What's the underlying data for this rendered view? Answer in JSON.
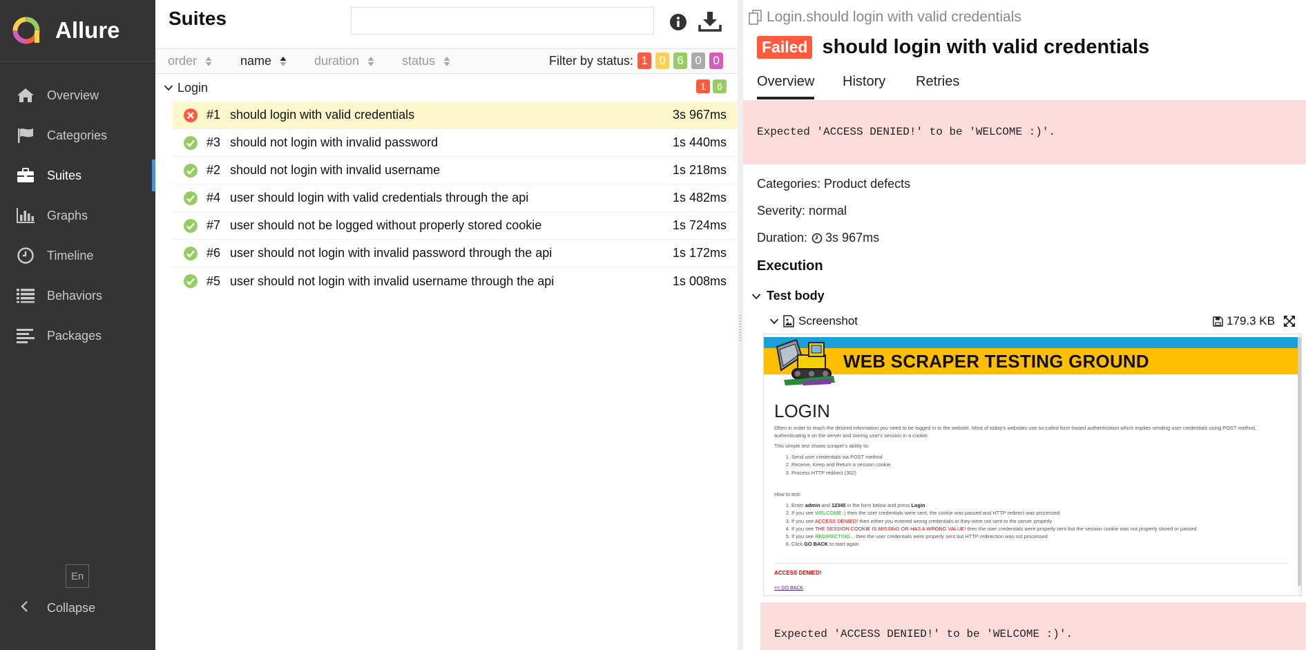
{
  "app": {
    "name": "Allure"
  },
  "sidebar": {
    "items": [
      {
        "label": "Overview",
        "icon": "home-icon"
      },
      {
        "label": "Categories",
        "icon": "flag-icon"
      },
      {
        "label": "Suites",
        "icon": "briefcase-icon",
        "active": true
      },
      {
        "label": "Graphs",
        "icon": "bar-chart-icon"
      },
      {
        "label": "Timeline",
        "icon": "clock-icon"
      },
      {
        "label": "Behaviors",
        "icon": "list-icon"
      },
      {
        "label": "Packages",
        "icon": "align-left-icon"
      }
    ],
    "language": "En",
    "collapse_label": "Collapse"
  },
  "suites": {
    "title": "Suites",
    "search_value": "",
    "sort_columns": [
      "order",
      "name",
      "duration",
      "status"
    ],
    "active_sort": "name",
    "filter_label": "Filter by status:",
    "filter_counts": {
      "failed": "1",
      "broken": "0",
      "passed": "6",
      "skipped": "0",
      "unknown": "0"
    },
    "group": {
      "name": "Login",
      "failed": "1",
      "passed": "6"
    },
    "tests": [
      {
        "num": "#1",
        "name": "should login with valid credentials",
        "duration": "3s 967ms",
        "status": "failed",
        "selected": true
      },
      {
        "num": "#3",
        "name": "should not login with invalid password",
        "duration": "1s 440ms",
        "status": "passed"
      },
      {
        "num": "#2",
        "name": "should not login with invalid username",
        "duration": "1s 218ms",
        "status": "passed"
      },
      {
        "num": "#4",
        "name": "user should login with valid credentials through the api",
        "duration": "1s 482ms",
        "status": "passed"
      },
      {
        "num": "#7",
        "name": "user should not be logged without properly stored cookie",
        "duration": "1s 724ms",
        "status": "passed"
      },
      {
        "num": "#6",
        "name": "user should not login with invalid password through the api",
        "duration": "1s 172ms",
        "status": "passed"
      },
      {
        "num": "#5",
        "name": "user should not login with invalid username through the api",
        "duration": "1s 008ms",
        "status": "passed"
      }
    ]
  },
  "detail": {
    "path": "Login.should login with valid credentials",
    "status_badge": "Failed",
    "title": "should login with valid credentials",
    "tabs": [
      "Overview",
      "History",
      "Retries"
    ],
    "error_message": "Expected 'ACCESS DENIED!' to be 'WELCOME :)'.",
    "categories": "Categories: Product defects",
    "severity": "Severity: normal",
    "duration_label": "Duration:",
    "duration_value": "3s 967ms",
    "execution_title": "Execution",
    "test_body_label": "Test body",
    "attachment": {
      "name": "Screenshot",
      "size": "179.3 KB"
    },
    "screenshot": {
      "banner": "WEB SCRAPER TESTING GROUND",
      "heading": "LOGIN",
      "intro": "Often in order to reach the desired information you need to be logged in to the website. Most of today's websites use so-called form-based authentication which implies sending user credentials using POST method, authenticating it on the server and storing user's session in a cookie.",
      "simple_test": "This simple test shows scraper's ability to:",
      "abilities": [
        "Send user credentials via POST method",
        "Receive, Keep and Return a session cookie",
        "Process HTTP redirect (302)"
      ],
      "how_to": "How to test:",
      "steps": {
        "s1a": "Enter ",
        "s1b": "admin",
        "s1c": " and ",
        "s1d": "12345",
        "s1e": " in the form below and press ",
        "s1f": "Login",
        "s2a": "If you see ",
        "s2b": "WELCOME :)",
        "s2c": " then the user credentials were sent, the cookie was passed and HTTP redirect was processed",
        "s3a": "If you see ",
        "s3b": "ACCESS DENIED!",
        "s3c": " then either you entered wrong credentials or they were not sent to the server properly",
        "s4a": "If you see ",
        "s4b": "THE SESSION COOKIE IS MISSING OR HAS A WRONG VALUE!",
        "s4c": " then the user credentials were properly sent but the session cookie was not properly stored or passed",
        "s5a": "If you see ",
        "s5b": "REDIRECTING...",
        "s5c": " then the user credentials were properly sent but HTTP redirection was not processed",
        "s6a": "Click ",
        "s6b": "GO BACK",
        "s6c": " to start again"
      },
      "denied": "ACCESS DENIED!",
      "go_back": "<< GO BACK"
    },
    "error_message_2": "Expected 'ACCESS DENIED!' to be 'WELCOME :)'."
  },
  "colors": {
    "sidebar_bg": "#343434",
    "failed": "#fd5a3e",
    "broken": "#ffd050",
    "passed": "#97cc64",
    "skipped": "#aaaaaa",
    "unknown": "#d35ebe",
    "error_bg": "#fddcdc",
    "selected_row": "#fdf7cc"
  }
}
